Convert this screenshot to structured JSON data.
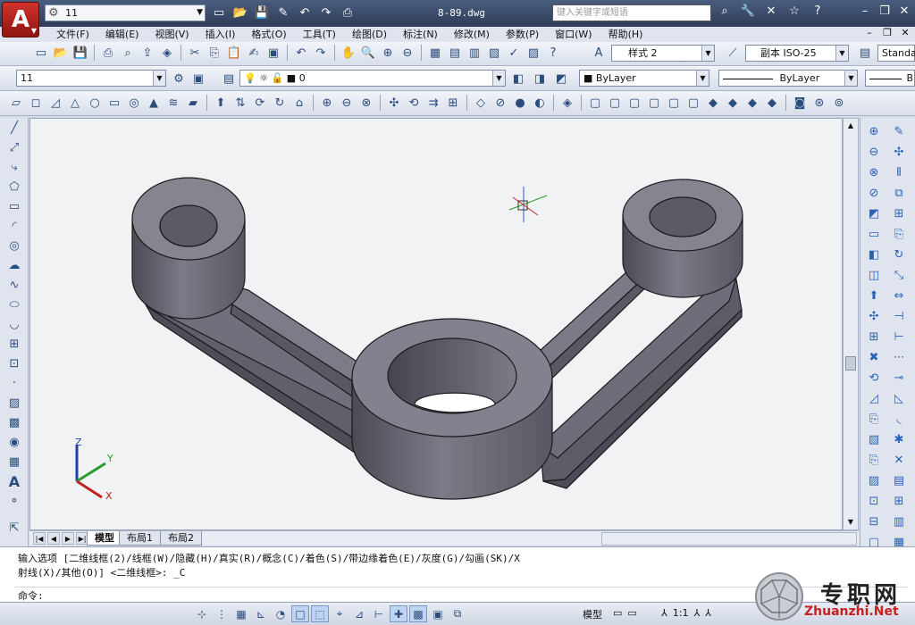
{
  "title_bar": {
    "workspace": "11",
    "file_title": "8-89.dwg",
    "search_placeholder": "键入关键字或短语"
  },
  "menu": {
    "items": [
      "文件(F)",
      "编辑(E)",
      "视图(V)",
      "插入(I)",
      "格式(O)",
      "工具(T)",
      "绘图(D)",
      "标注(N)",
      "修改(M)",
      "参数(P)",
      "窗口(W)",
      "帮助(H)"
    ]
  },
  "toolbar2": {
    "text_style": "样式 2",
    "dim_style": "副本 ISO-25",
    "table_style": "Standa"
  },
  "toolbar3": {
    "workspace_combo": "11",
    "layer_combo": "0",
    "color_combo": "ByLayer",
    "linetype_combo": "ByLayer",
    "lineweight_combo": "B"
  },
  "layout_tabs": {
    "model": "模型",
    "layout1": "布局1",
    "layout2": "布局2"
  },
  "ucs": {
    "x": "X",
    "y": "Y",
    "z": "Z"
  },
  "command": {
    "line1": "输入选项 [二维线框(2)/线框(W)/隐藏(H)/真实(R)/概念(C)/着色(S)/带边缘着色(E)/灰度(G)/勾画(SK)/X",
    "line2": "射线(X)/其他(O)] <二维线框>: _C",
    "prompt": "命令:"
  },
  "status": {
    "model": "模型",
    "scale": "1:1"
  },
  "watermark": {
    "text": "专职网",
    "url": "Zhuanzhi.Net"
  },
  "colors": {
    "title_bg": "#3b4d6b",
    "viewport_bg": "#f1f2f4",
    "part_fill": "#6e6f7a",
    "part_edge": "#1a1a1e"
  }
}
